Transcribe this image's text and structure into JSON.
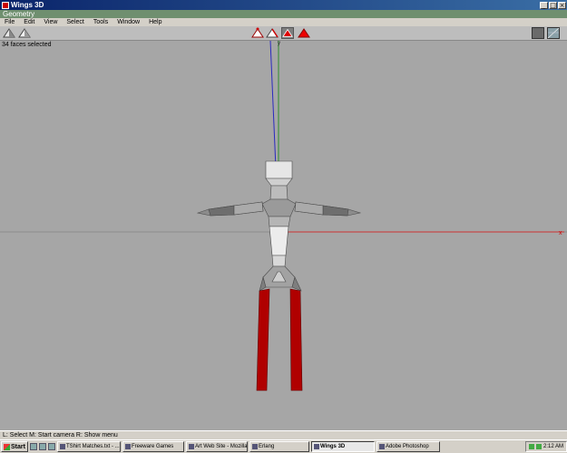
{
  "window": {
    "title": "Wings 3D",
    "geometry_title": "Geometry"
  },
  "menu": [
    "File",
    "Edit",
    "View",
    "Select",
    "Tools",
    "Window",
    "Help"
  ],
  "viewport": {
    "info_text": "34 faces selected",
    "axis_labels": {
      "y": "y",
      "x": "x"
    }
  },
  "status": {
    "text": "L: Select   M: Start camera   R: Show menu"
  },
  "taskbar": {
    "start_label": "Start",
    "tasks": [
      {
        "label": "TShirt Matches.txt - ..."
      },
      {
        "label": "Freeware Games"
      },
      {
        "label": "Art Web Site - Mozilla"
      },
      {
        "label": "Erlang"
      },
      {
        "label": "Wings 3D"
      },
      {
        "label": "Adobe Photoshop"
      }
    ],
    "clock": "2:12 AM"
  },
  "colors": {
    "viewport_bg": "#a6a6a6",
    "selected_face": "#b00000",
    "mesh_gray": "#c8c8c8"
  }
}
